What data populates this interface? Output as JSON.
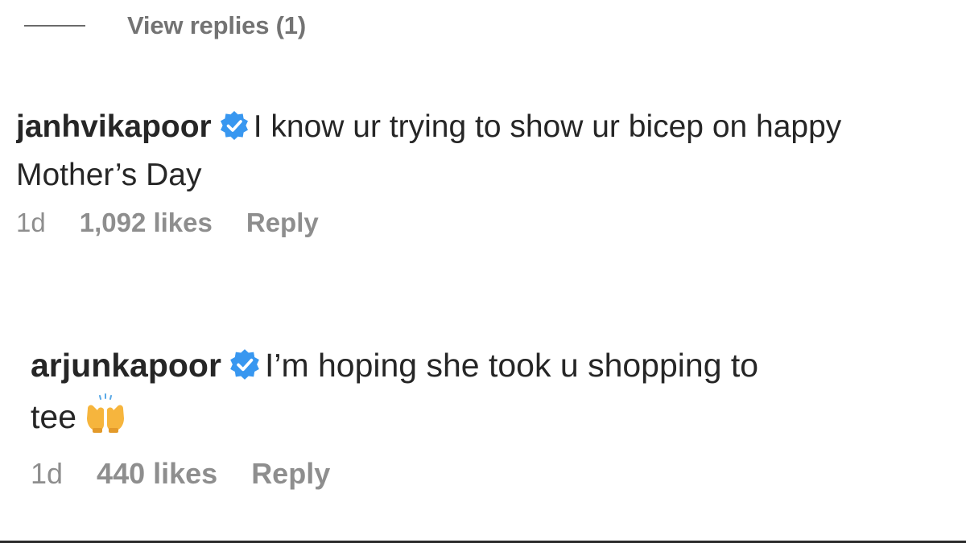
{
  "view_replies": {
    "label": "View replies (1)"
  },
  "comments": [
    {
      "username": "janhvikapoor",
      "verified": true,
      "line1": "I know ur trying to show ur bicep on happy",
      "line2": "Mother’s Day",
      "time": "1d",
      "likes": "1,092 likes",
      "reply_label": "Reply"
    },
    {
      "username": "arjunkapoor",
      "verified": true,
      "line1": "I’m hoping she took u shopping to",
      "line2": "tee",
      "emoji": "raising-hands-emoji",
      "time": "1d",
      "likes": "440 likes",
      "reply_label": "Reply"
    }
  ],
  "colors": {
    "verified_badge": "#3897f0",
    "meta_text": "#8e8e8e",
    "primary_text": "#262626",
    "emoji": "#f6b53d"
  }
}
